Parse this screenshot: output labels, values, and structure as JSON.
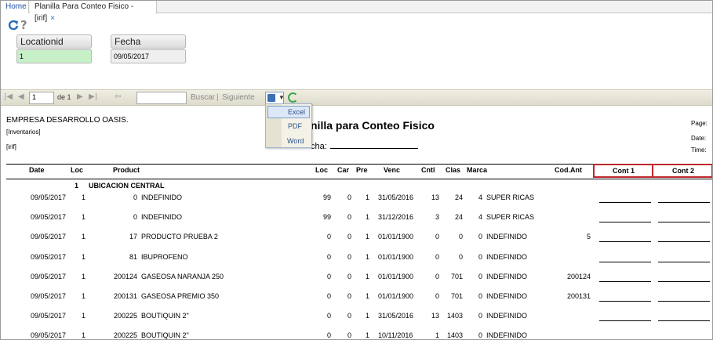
{
  "tabs": {
    "home": "Home",
    "active": "Planilla Para Conteo Fisico -[irif]",
    "close": "×"
  },
  "params": {
    "location_label": "Locationid",
    "location_value": "1",
    "fecha_label": "Fecha",
    "fecha_value": "09/05/2017"
  },
  "toolbar": {
    "page": "1",
    "of_text": "de 1",
    "find": "Buscar",
    "separator": "|",
    "next": "Siguiente",
    "icons": [
      "first-page-icon",
      "prev-page-icon",
      "next-page-icon",
      "last-page-icon",
      "back-icon",
      "export-icon",
      "refresh-icon"
    ]
  },
  "export_menu": {
    "excel": "Excel",
    "pdf": "PDF",
    "word": "Word"
  },
  "report": {
    "company": "EMPRESA DESARROLLO OASIS.",
    "module": "[Inventarios]",
    "code": "[irif]",
    "title": "nilla para Conteo Fisico",
    "fecha_label": "cha:",
    "page_label": "Page:",
    "date_label": "Date:",
    "time_label": "Time:",
    "columns": {
      "date": "Date",
      "loc": "Loc",
      "product": "Product",
      "loc2": "Loc",
      "car": "Car",
      "pre": "Pre",
      "venc": "Venc",
      "cntl": "Cntl",
      "clas": "Clas",
      "marca": "Marca",
      "codant": "Cod.Ant",
      "cont1": "Cont 1",
      "cont2": "Cont 2"
    },
    "section_num": "1",
    "section_name": "UBICACION CENTRAL",
    "rows": [
      {
        "date": "09/05/2017",
        "loc": "1",
        "code": "0",
        "name": "INDEFINIDO",
        "loc2": "99",
        "car": "0",
        "pre": "1",
        "venc": "31/05/2016",
        "cntl": "13",
        "clas": "24",
        "mnum": "4",
        "marca": "SUPER RICAS",
        "codant": ""
      },
      {
        "date": "09/05/2017",
        "loc": "1",
        "code": "0",
        "name": "INDEFINIDO",
        "loc2": "99",
        "car": "0",
        "pre": "1",
        "venc": "31/12/2016",
        "cntl": "3",
        "clas": "24",
        "mnum": "4",
        "marca": "SUPER RICAS",
        "codant": ""
      },
      {
        "date": "09/05/2017",
        "loc": "1",
        "code": "17",
        "name": "PRODUCTO PRUEBA 2",
        "loc2": "0",
        "car": "0",
        "pre": "1",
        "venc": "01/01/1900",
        "cntl": "0",
        "clas": "0",
        "mnum": "0",
        "marca": "INDEFINIDO",
        "codant": "5"
      },
      {
        "date": "09/05/2017",
        "loc": "1",
        "code": "81",
        "name": "IBUPROFENO",
        "loc2": "0",
        "car": "0",
        "pre": "1",
        "venc": "01/01/1900",
        "cntl": "0",
        "clas": "0",
        "mnum": "0",
        "marca": "INDEFINIDO",
        "codant": ""
      },
      {
        "date": "09/05/2017",
        "loc": "1",
        "code": "200124",
        "name": "GASEOSA NARANJA 250",
        "loc2": "0",
        "car": "0",
        "pre": "1",
        "venc": "01/01/1900",
        "cntl": "0",
        "clas": "701",
        "mnum": "0",
        "marca": "INDEFINIDO",
        "codant": "200124"
      },
      {
        "date": "09/05/2017",
        "loc": "1",
        "code": "200131",
        "name": "GASEOSA PREMIO 350",
        "loc2": "0",
        "car": "0",
        "pre": "1",
        "venc": "01/01/1900",
        "cntl": "0",
        "clas": "701",
        "mnum": "0",
        "marca": "INDEFINIDO",
        "codant": "200131"
      },
      {
        "date": "09/05/2017",
        "loc": "1",
        "code": "200225",
        "name": "BOUTIQUIN 2\"",
        "loc2": "0",
        "car": "0",
        "pre": "1",
        "venc": "31/05/2016",
        "cntl": "13",
        "clas": "1403",
        "mnum": "0",
        "marca": "INDEFINIDO",
        "codant": ""
      },
      {
        "date": "09/05/2017",
        "loc": "1",
        "code": "200225",
        "name": "BOUTIQUIN 2\"",
        "loc2": "0",
        "car": "0",
        "pre": "1",
        "venc": "10/11/2016",
        "cntl": "1",
        "clas": "1403",
        "mnum": "0",
        "marca": "INDEFINIDO",
        "codant": ""
      }
    ]
  }
}
